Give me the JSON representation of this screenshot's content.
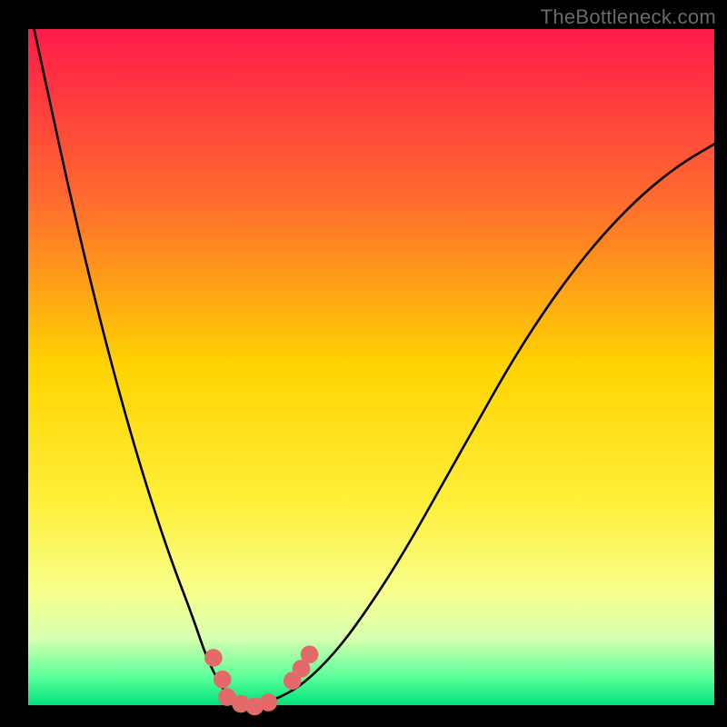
{
  "watermark": "TheBottleneck.com",
  "chart_data": {
    "type": "line",
    "title": "",
    "xlabel": "",
    "ylabel": "",
    "xlim": [
      0,
      100
    ],
    "ylim": [
      0,
      100
    ],
    "gradient_stops": [
      {
        "offset": 0,
        "color": "#ff1a4a"
      },
      {
        "offset": 25,
        "color": "#ff6a2e"
      },
      {
        "offset": 50,
        "color": "#ffd400"
      },
      {
        "offset": 70,
        "color": "#ffef3a"
      },
      {
        "offset": 83,
        "color": "#f8ff8a"
      },
      {
        "offset": 90,
        "color": "#d8ffb0"
      },
      {
        "offset": 96,
        "color": "#57ff99"
      },
      {
        "offset": 100,
        "color": "#00e07a"
      }
    ],
    "series": [
      {
        "name": "curve",
        "x": [
          0,
          3,
          6,
          9,
          12,
          15,
          18,
          21,
          24,
          26,
          28,
          29.5,
          31,
          33,
          36,
          40,
          45,
          50,
          55,
          60,
          65,
          70,
          75,
          80,
          85,
          90,
          95,
          100
        ],
        "y": [
          104,
          90,
          76,
          63,
          51,
          40,
          30,
          21,
          13,
          7,
          3,
          0.8,
          0,
          0,
          0.8,
          3,
          8,
          15,
          23,
          32,
          41,
          50,
          58,
          65,
          71,
          76,
          80,
          83
        ]
      }
    ],
    "markers": {
      "name": "dots",
      "coords": [
        {
          "x": 27.0,
          "y": 7.0
        },
        {
          "x": 28.3,
          "y": 3.8
        },
        {
          "x": 29.0,
          "y": 1.2
        },
        {
          "x": 31.0,
          "y": 0.2
        },
        {
          "x": 33.0,
          "y": -0.2
        },
        {
          "x": 35.0,
          "y": 0.4
        },
        {
          "x": 38.5,
          "y": 3.6
        },
        {
          "x": 39.8,
          "y": 5.4
        },
        {
          "x": 41.0,
          "y": 7.5
        }
      ],
      "color": "#e46a6a",
      "radius": 1.3
    }
  }
}
